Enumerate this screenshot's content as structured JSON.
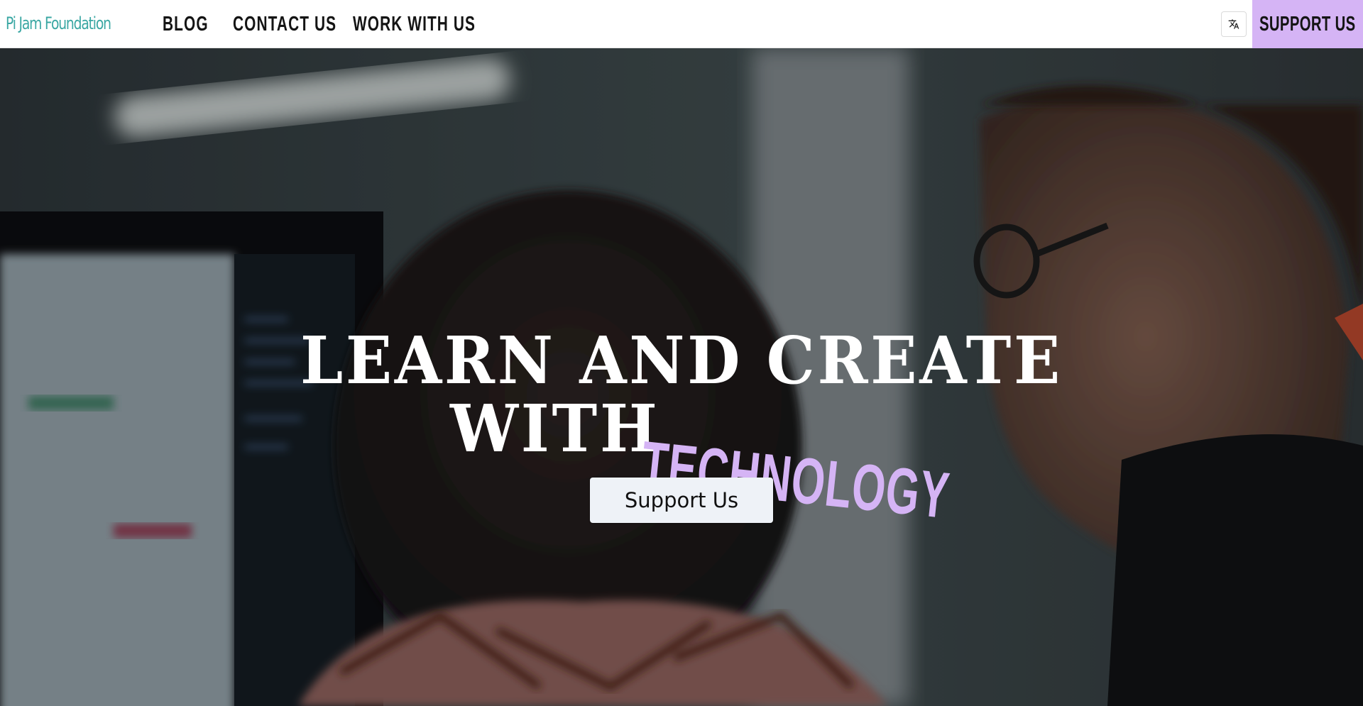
{
  "colors": {
    "brand_teal": "#3aa7a3",
    "accent_lavender": "#d5b4f5",
    "nav_text": "#141414",
    "button_bg": "#eef2f7"
  },
  "header": {
    "logo_text": "Pi Jam Foundation",
    "logo_icon": "mascot-icon",
    "nav": [
      {
        "label": "BLOG"
      },
      {
        "label": "CONTACT US"
      },
      {
        "label": "WORK WITH US"
      }
    ],
    "translate_icon": "translate-icon",
    "support_label": "SUPPORT US"
  },
  "hero": {
    "headline_line1": "LEARN AND CREATE",
    "headline_with": "WITH",
    "headline_accent": "TECHNOLOGY",
    "cta_label": "Support Us"
  }
}
